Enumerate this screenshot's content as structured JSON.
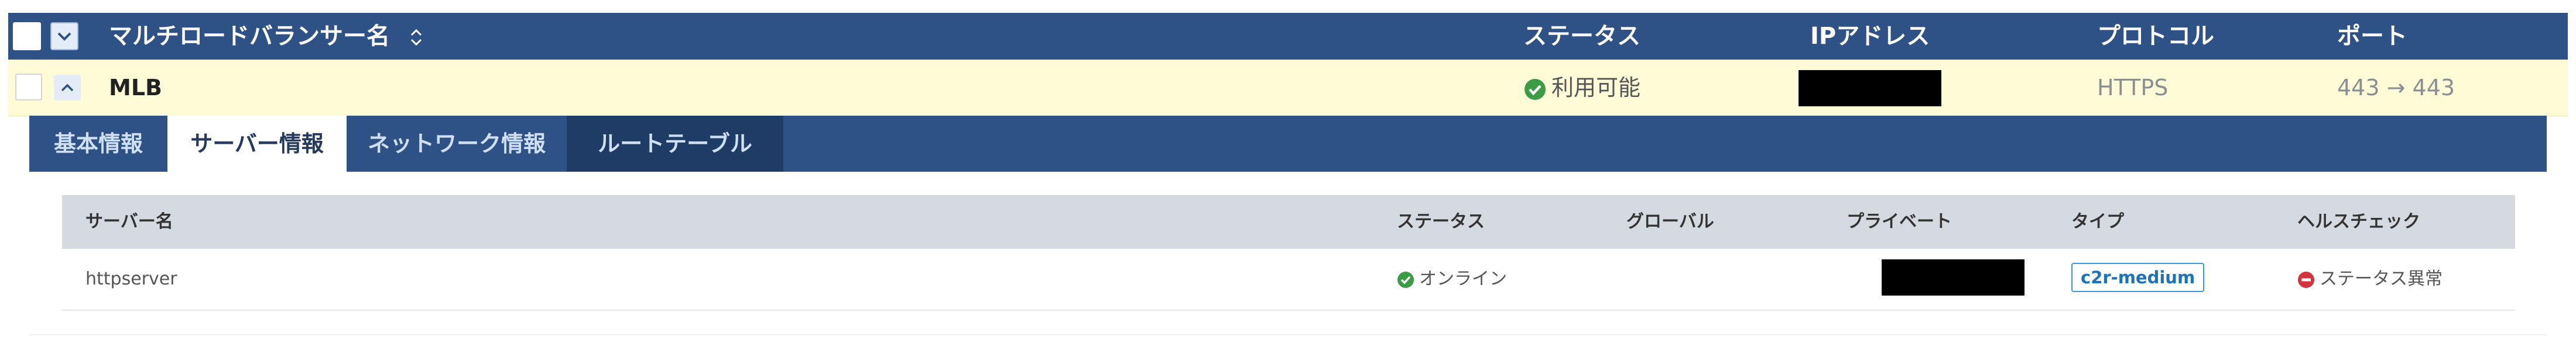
{
  "header": {
    "name_label": "マルチロードバランサー名",
    "status_label": "ステータス",
    "ip_label": "IPアドレス",
    "protocol_label": "プロトコル",
    "port_label": "ポート"
  },
  "lb_row": {
    "name": "MLB",
    "status": "利用可能",
    "protocol": "HTTPS",
    "port": "443 → 443"
  },
  "tabs": [
    {
      "label": "基本情報",
      "active": false
    },
    {
      "label": "サーバー情報",
      "active": true
    },
    {
      "label": "ネットワーク情報",
      "active": false
    },
    {
      "label": "ルートテーブル",
      "active": false
    }
  ],
  "server_table": {
    "columns": [
      "サーバー名",
      "ステータス",
      "グローバル",
      "プライベート",
      "タイプ",
      "ヘルスチェック"
    ],
    "rows": [
      {
        "name": "httpserver",
        "status": "オンライン",
        "global": "",
        "type": "c2r-medium",
        "health": "ステータス異常"
      }
    ]
  },
  "colors": {
    "header_bg": "#2e5285",
    "row_highlight": "#fffbd6",
    "ok_green": "#3c9c46",
    "error_red": "#d3343b",
    "badge_blue": "#3a9ad9"
  },
  "icons": [
    "sort-icon",
    "chevron-down-icon",
    "chevron-up-icon",
    "check-circle-icon",
    "minus-circle-icon"
  ]
}
